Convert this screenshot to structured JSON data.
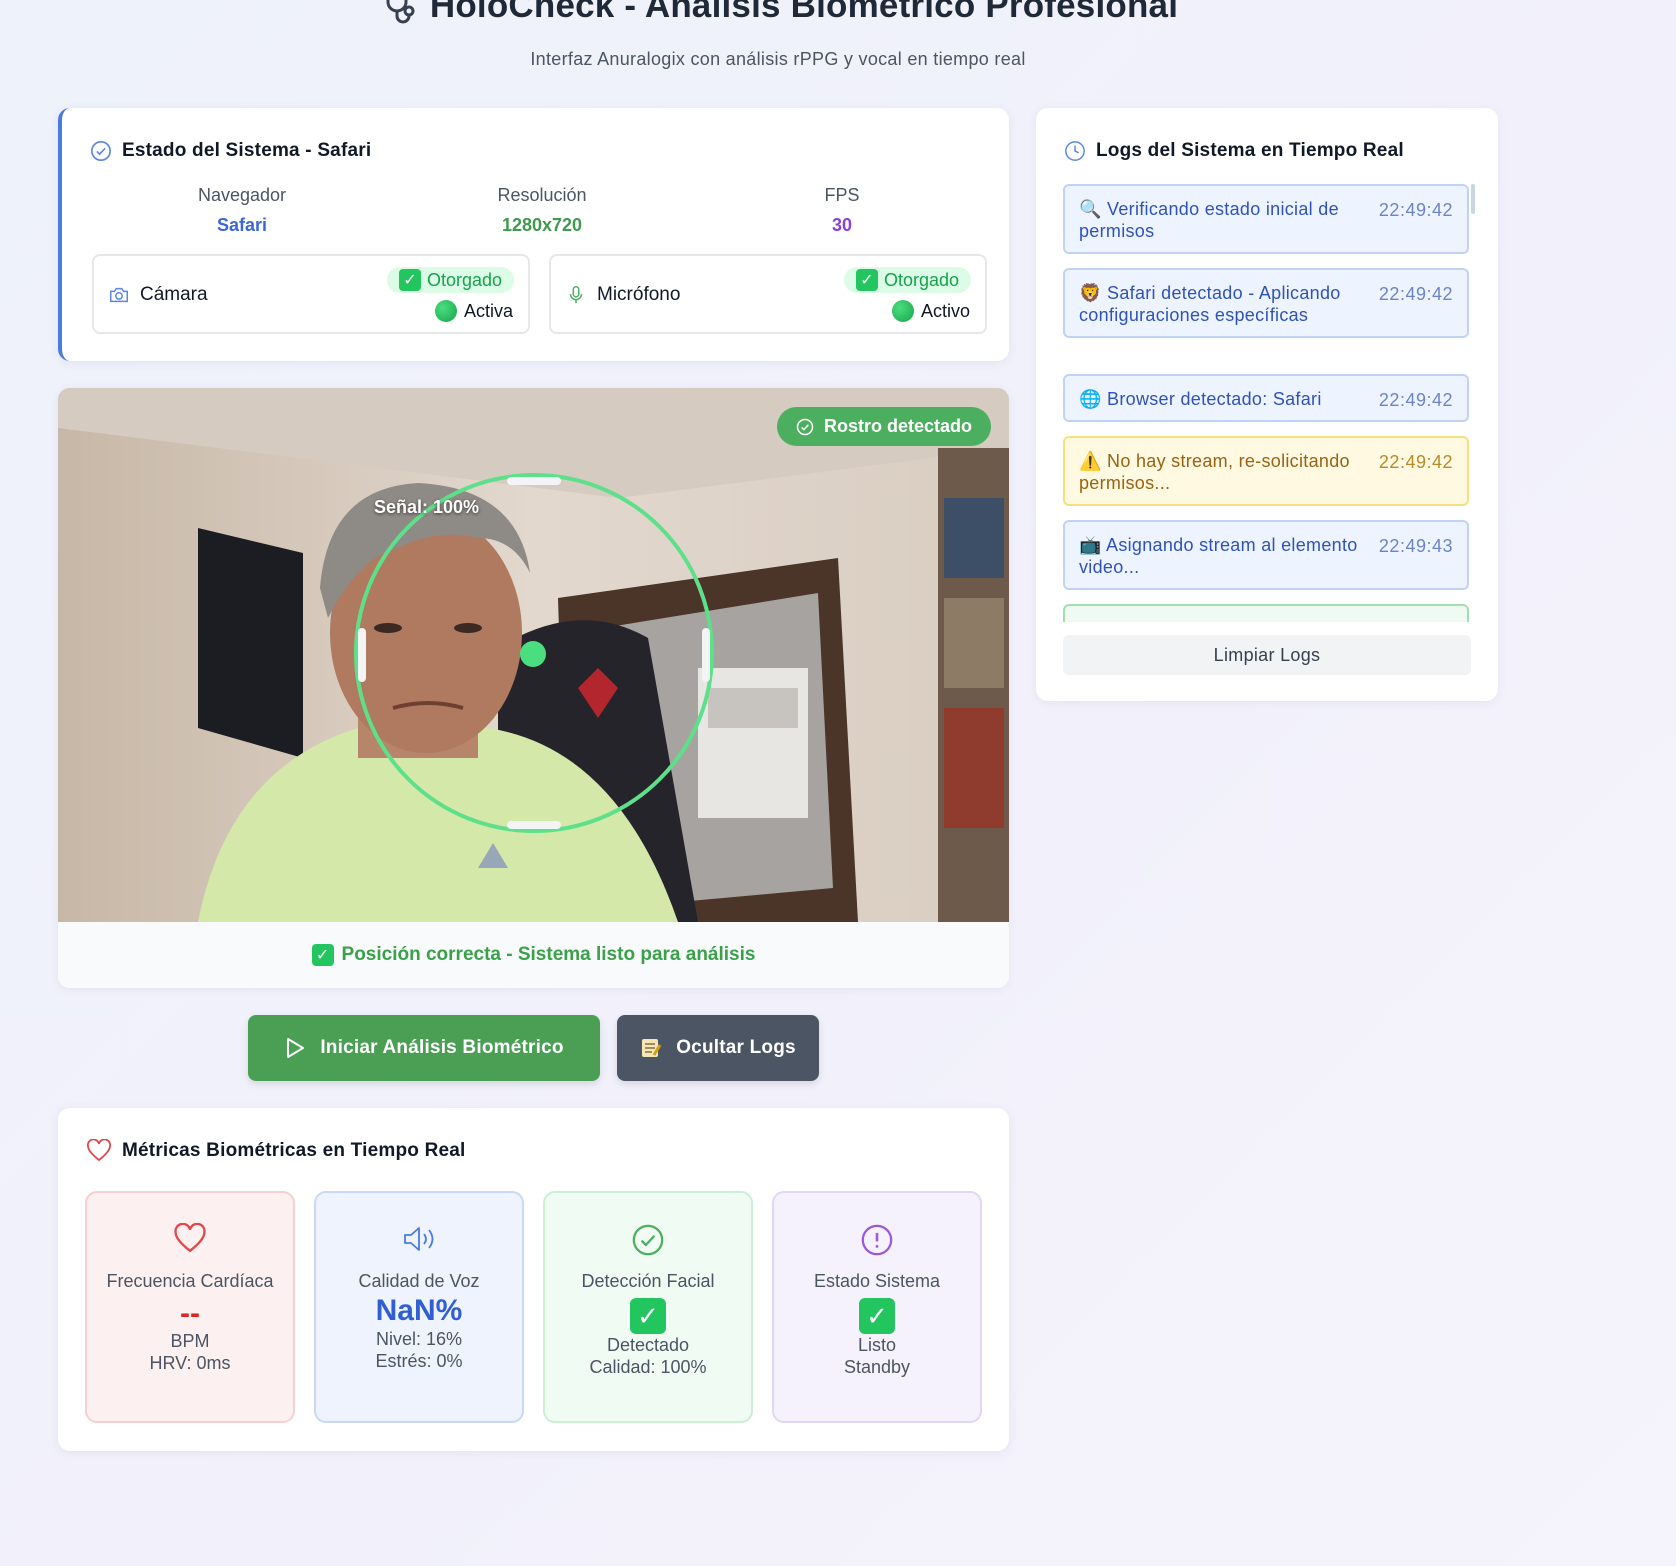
{
  "header": {
    "title": "HoloCheck - Análisis Biométrico Profesional",
    "subtitle": "Interfaz Anuralogix con análisis rPPG y vocal en tiempo real"
  },
  "status": {
    "title": "Estado del Sistema - Safari",
    "stats": [
      {
        "label": "Navegador",
        "value": "Safari",
        "color": "#3b67d6"
      },
      {
        "label": "Resolución",
        "value": "1280x720",
        "color": "#3f9a4c"
      },
      {
        "label": "FPS",
        "value": "30",
        "color": "#8b3fd6"
      }
    ],
    "camera": {
      "label": "Cámara",
      "badge": "Otorgado",
      "state": "Activa"
    },
    "microphone": {
      "label": "Micrófono",
      "badge": "Otorgado",
      "state": "Activo"
    }
  },
  "video": {
    "face_badge": "Rostro detectado",
    "signal": "Señal: 100%",
    "status_text": "Posición correcta - Sistema listo para análisis"
  },
  "buttons": {
    "start": "Iniciar Análisis Biométrico",
    "toggle_logs": "Ocultar Logs"
  },
  "metrics": {
    "title": "Métricas Biométricas en Tiempo Real",
    "heart": {
      "name": "Frecuencia Cardíaca",
      "value": "--",
      "unit": "BPM",
      "extra": "HRV: 0ms"
    },
    "voice": {
      "name": "Calidad de Voz",
      "value": "NaN%",
      "level": "Nivel: 16%",
      "stress": "Estrés: 0%"
    },
    "face": {
      "name": "Detección Facial",
      "state": "Detectado",
      "quality": "Calidad: 100%"
    },
    "system": {
      "name": "Estado Sistema",
      "state": "Listo",
      "mode": "Standby"
    }
  },
  "logs": {
    "title": "Logs del Sistema en Tiempo Real",
    "entries": [
      {
        "icon": "🔍",
        "text": "Verificando estado inicial de permisos",
        "time": "22:49:42",
        "type": "info"
      },
      {
        "icon": "🦁",
        "text": "Safari detectado - Aplicando configuraciones específicas",
        "time": "22:49:42",
        "type": "info"
      },
      {
        "icon": "🌐",
        "text": "Browser detectado: Safari",
        "time": "22:49:42",
        "type": "info"
      },
      {
        "icon": "⚠️",
        "text": "No hay stream, re-solicitando permisos...",
        "time": "22:49:42",
        "type": "warn"
      },
      {
        "icon": "📺",
        "text": "Asignando stream al elemento video...",
        "time": "22:49:43",
        "type": "info"
      }
    ],
    "clear_label": "Limpiar Logs"
  }
}
